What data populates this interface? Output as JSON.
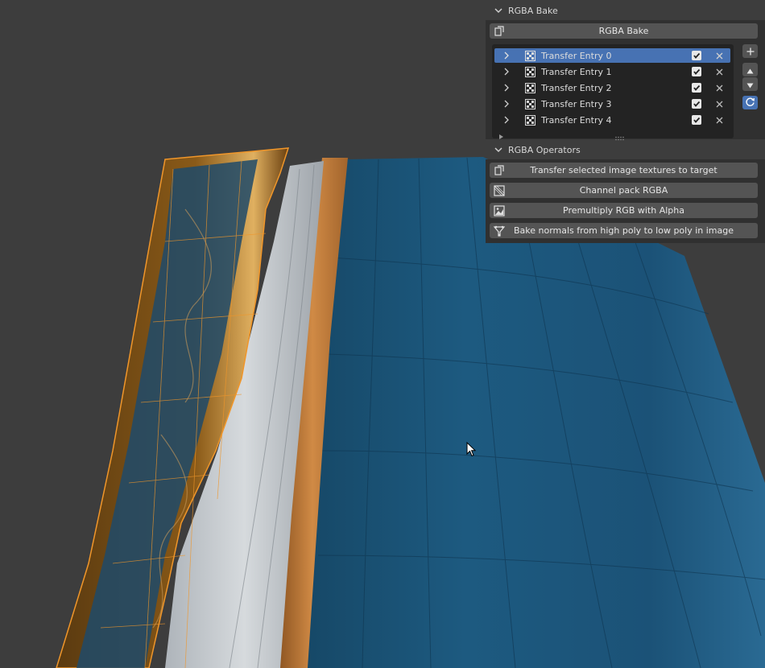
{
  "rgba_bake_panel": {
    "title": "RGBA Bake",
    "bake_button_label": "RGBA Bake",
    "entries": [
      {
        "label": "Transfer Entry 0",
        "enabled": true,
        "active": true
      },
      {
        "label": "Transfer Entry 1",
        "enabled": true,
        "active": false
      },
      {
        "label": "Transfer Entry 2",
        "enabled": true,
        "active": false
      },
      {
        "label": "Transfer Entry 3",
        "enabled": true,
        "active": false
      },
      {
        "label": "Transfer Entry 4",
        "enabled": true,
        "active": false
      }
    ]
  },
  "rgba_operators_panel": {
    "title": "RGBA Operators",
    "operators": [
      {
        "label": "Transfer selected image textures to target",
        "icon": "transfer-icon"
      },
      {
        "label": "Channel pack RGBA",
        "icon": "channel-pack-icon"
      },
      {
        "label": "Premultiply RGB with Alpha",
        "icon": "premultiply-icon"
      },
      {
        "label": "Bake normals from high poly to low poly in image",
        "icon": "bake-normals-icon"
      }
    ]
  },
  "colors": {
    "active_row": "#4772b3",
    "panel_bg": "#303030",
    "button_bg": "#545454",
    "viewport_bg": "#3d3d3d",
    "cloth_blue": "#1d5579",
    "wood_orange": "#c8823e"
  }
}
